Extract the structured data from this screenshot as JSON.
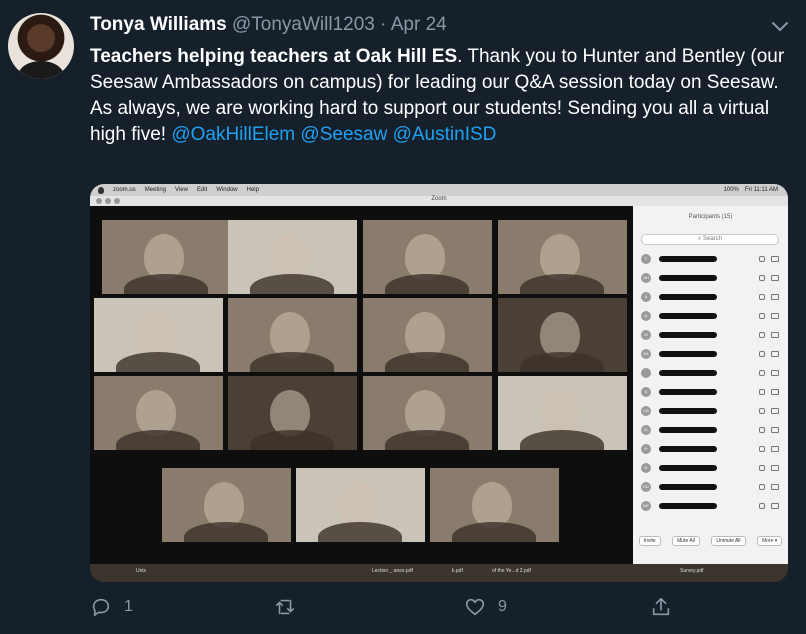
{
  "tweet": {
    "author_name": "Tonya Williams",
    "handle": "@TonyaWill1203",
    "separator": "·",
    "date": "Apr 24",
    "text_bold": "Teachers helping teachers at Oak Hill ES",
    "text_1": ". Thank you to Hunter and Bentley (our Seesaw Ambassadors on campus) for leading our Q&A session today on Seesaw. As always, we are working hard to support our students! Sending you all a virtual high five! ",
    "mention_1": "@OakHillElem",
    "mention_2": "@Seesaw",
    "mention_3": "@AustinISD"
  },
  "zoom": {
    "menubar": {
      "items": [
        "zoom.us",
        "Meeting",
        "View",
        "Edit",
        "Window",
        "Help"
      ],
      "battery": "100%",
      "clock": "Fri 11:11 AM"
    },
    "window_title": "Zoom",
    "participants_title": "Participants (15)",
    "search_placeholder": "Search",
    "initials": [
      "T",
      "AH",
      "A",
      "JL",
      "M",
      "KA",
      "",
      "S",
      "CB",
      "CL",
      "H",
      "N",
      "KD",
      "MF"
    ],
    "footer_buttons": [
      "Invite",
      "Mute All",
      "Unmute All",
      "More ▾"
    ],
    "dock_files": [
      "Unis",
      "Lection _ anes.pdf",
      "k.pdf",
      "of the Ye...d 2.pdf",
      "Survey.pdf"
    ]
  },
  "actions": {
    "reply_count": "1",
    "retweet_count": "",
    "like_count": "9"
  },
  "colors": {
    "background": "#15202b",
    "secondary_text": "#8899a6",
    "link": "#1da1f2"
  }
}
